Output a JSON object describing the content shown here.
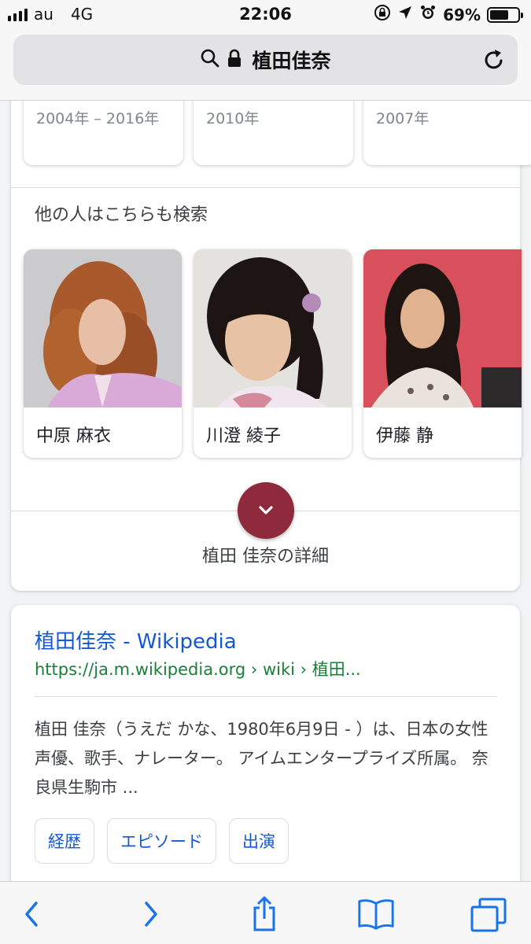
{
  "status_bar": {
    "carrier": "au",
    "network": "4G",
    "time": "22:06",
    "battery": "69%",
    "battery_level": 0.69
  },
  "address_bar": {
    "query": "植田佳奈",
    "icons": [
      "search-icon",
      "lock-icon",
      "reload-icon"
    ]
  },
  "knowledge_panel": {
    "year_cards": [
      "2004年 – 2016年",
      "2010年",
      "2007年"
    ],
    "people_also_search_title": "他の人はこちらも検索",
    "people": [
      {
        "name": "中原 麻衣"
      },
      {
        "name": "川澄 綾子"
      },
      {
        "name": "伊藤 静"
      }
    ],
    "details_label": "植田 佳奈の詳細",
    "expand_icon": "chevron-down-icon",
    "accent_color": "#8e2a3b"
  },
  "result": {
    "title": "植田佳奈 - Wikipedia",
    "url": "https://ja.m.wikipedia.org › wiki › 植田...",
    "snippet": "植田 佳奈（うえだ かな、1980年6月9日 - ）は、日本の女性声優、歌手、ナレーター。 アイムエンタープライズ所属。 奈良県生駒市 ...",
    "chips": [
      "経歴",
      "エピソード",
      "出演"
    ]
  },
  "toolbar": {
    "icons": [
      "back-icon",
      "forward-icon",
      "share-icon",
      "bookmarks-icon",
      "tabs-icon"
    ],
    "color": "#1a73e8"
  }
}
